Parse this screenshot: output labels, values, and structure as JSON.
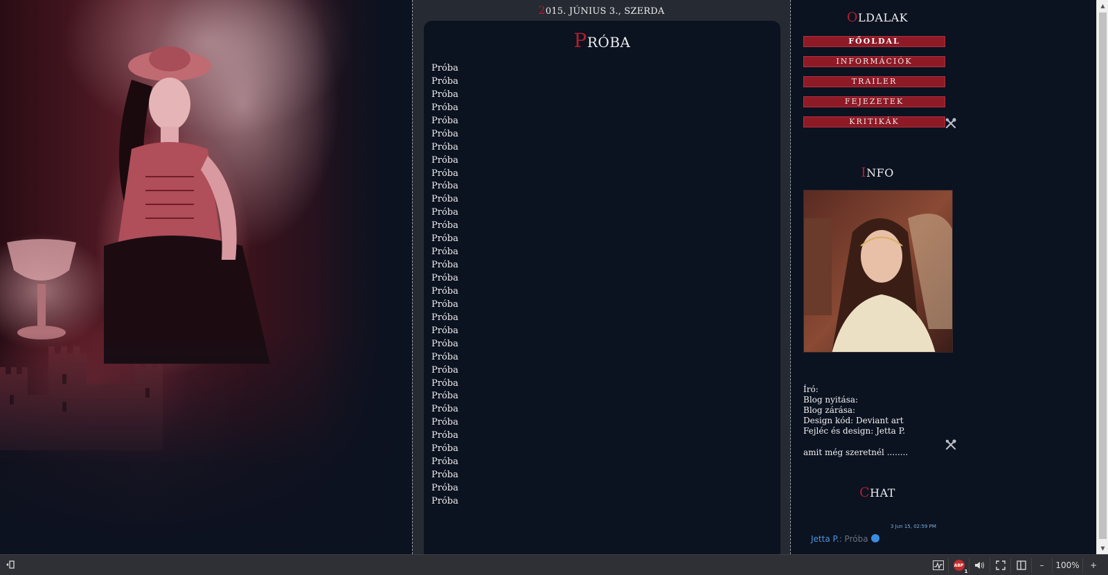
{
  "header": {
    "date_first": "2",
    "date_rest": "015. JÚNIUS 3., SZERDA"
  },
  "post": {
    "title_first": "P",
    "title_rest": "RÓBA",
    "lines": [
      "Próba",
      "Próba",
      "Próba",
      "Próba",
      "Próba",
      "Próba",
      "Próba",
      "Próba",
      "Próba",
      "Próba",
      "Próba",
      "Próba",
      "Próba",
      "Próba",
      "Próba",
      "Próba",
      "Próba",
      "Próba",
      "Próba",
      "Próba",
      "Próba",
      "Próba",
      "Próba",
      "Próba",
      "Próba",
      "Próba",
      "Próba",
      "Próba",
      "Próba",
      "Próba",
      "Próba",
      "Próba",
      "Próba",
      "Próba"
    ]
  },
  "sidebar": {
    "pages_title_first": "O",
    "pages_title_rest": "LDALAK",
    "nav": [
      "FŐOLDAL",
      "INFORMÁCIÓK",
      "TRAILER",
      "FEJEZETEK",
      "KRITIKÁK"
    ],
    "info_title_first": "I",
    "info_title_rest": "NFO",
    "info_lines": [
      "Író:",
      "Blog nyitása:",
      "Blog zárása:",
      "Design kód: Deviant art",
      "Fejléc és design: Jetta P."
    ],
    "extra_text": "amit még szeretnél ........",
    "chat_title_first": "C",
    "chat_title_rest": "HAT",
    "chat": {
      "time": "3 Jun 15, 02:59 PM",
      "user": "Jetta P.",
      "sep": ":",
      "message": " Próba"
    }
  },
  "statusbar": {
    "zoom": "100%",
    "abp_label": "ABP",
    "abp_count": "1",
    "minus": "–",
    "plus": "+"
  },
  "colors": {
    "accent_red": "#b01e2e",
    "nav_button": "#8e1a26",
    "page_bg": "#0b1220",
    "chat_user": "#4f95e0"
  }
}
